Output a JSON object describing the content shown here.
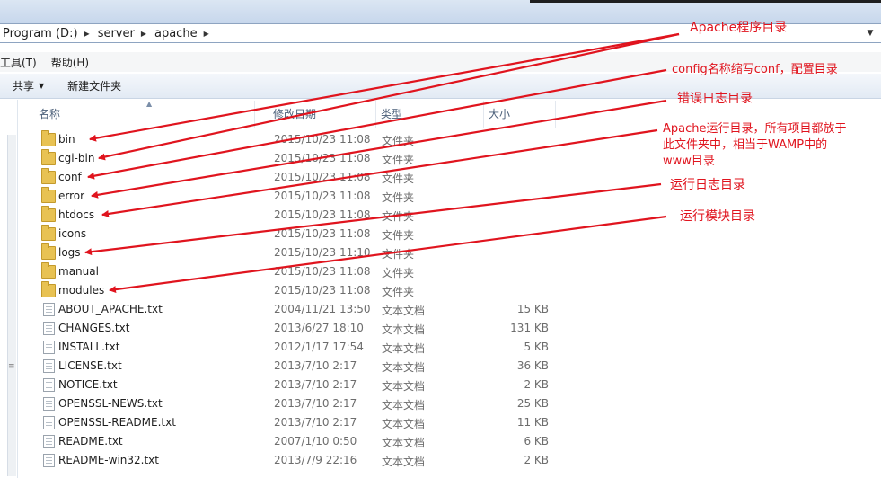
{
  "address": {
    "crumbs": [
      "Program (D:)",
      "server",
      "apache"
    ]
  },
  "menu": [
    "工具(T)",
    "帮助(H)"
  ],
  "toolbar": {
    "share_label": "共享",
    "new_folder_label": "新建文件夹"
  },
  "columns": {
    "name": "名称",
    "date": "修改日期",
    "type": "类型",
    "size": "大小"
  },
  "files": [
    {
      "name": "bin",
      "date": "2015/10/23 11:08",
      "type": "文件夹",
      "size": "",
      "kind": "folder"
    },
    {
      "name": "cgi-bin",
      "date": "2015/10/23 11:08",
      "type": "文件夹",
      "size": "",
      "kind": "folder"
    },
    {
      "name": "conf",
      "date": "2015/10/23 11:08",
      "type": "文件夹",
      "size": "",
      "kind": "folder"
    },
    {
      "name": "error",
      "date": "2015/10/23 11:08",
      "type": "文件夹",
      "size": "",
      "kind": "folder"
    },
    {
      "name": "htdocs",
      "date": "2015/10/23 11:08",
      "type": "文件夹",
      "size": "",
      "kind": "folder"
    },
    {
      "name": "icons",
      "date": "2015/10/23 11:08",
      "type": "文件夹",
      "size": "",
      "kind": "folder"
    },
    {
      "name": "logs",
      "date": "2015/10/23 11:10",
      "type": "文件夹",
      "size": "",
      "kind": "folder"
    },
    {
      "name": "manual",
      "date": "2015/10/23 11:08",
      "type": "文件夹",
      "size": "",
      "kind": "folder"
    },
    {
      "name": "modules",
      "date": "2015/10/23 11:08",
      "type": "文件夹",
      "size": "",
      "kind": "folder"
    },
    {
      "name": "ABOUT_APACHE.txt",
      "date": "2004/11/21 13:50",
      "type": "文本文档",
      "size": "15 KB",
      "kind": "file"
    },
    {
      "name": "CHANGES.txt",
      "date": "2013/6/27 18:10",
      "type": "文本文档",
      "size": "131 KB",
      "kind": "file"
    },
    {
      "name": "INSTALL.txt",
      "date": "2012/1/17 17:54",
      "type": "文本文档",
      "size": "5 KB",
      "kind": "file"
    },
    {
      "name": "LICENSE.txt",
      "date": "2013/7/10 2:17",
      "type": "文本文档",
      "size": "36 KB",
      "kind": "file"
    },
    {
      "name": "NOTICE.txt",
      "date": "2013/7/10 2:17",
      "type": "文本文档",
      "size": "2 KB",
      "kind": "file"
    },
    {
      "name": "OPENSSL-NEWS.txt",
      "date": "2013/7/10 2:17",
      "type": "文本文档",
      "size": "25 KB",
      "kind": "file"
    },
    {
      "name": "OPENSSL-README.txt",
      "date": "2013/7/10 2:17",
      "type": "文本文档",
      "size": "11 KB",
      "kind": "file"
    },
    {
      "name": "README.txt",
      "date": "2007/1/10 0:50",
      "type": "文本文档",
      "size": "6 KB",
      "kind": "file"
    },
    {
      "name": "README-win32.txt",
      "date": "2013/7/9 22:16",
      "type": "文本文档",
      "size": "2 KB",
      "kind": "file"
    }
  ],
  "annotations": {
    "bin": "Apache程序目录",
    "conf": "config名称缩写conf，配置目录",
    "error": "错误日志目录",
    "htdocs_line1": "Apache运行目录，所有项目都放于",
    "htdocs_line2": "此文件夹中，相当于WAMP中的",
    "htdocs_line3": "www目录",
    "logs": "运行日志目录",
    "modules": "运行模块目录"
  },
  "colors": {
    "annotation_red": "#e0141e",
    "folder": "#e8c253"
  },
  "icons": {
    "folder": "folder-icon",
    "file": "text-file-icon",
    "separator": "chevron-right-icon",
    "dropdown": "chevron-down-icon"
  }
}
